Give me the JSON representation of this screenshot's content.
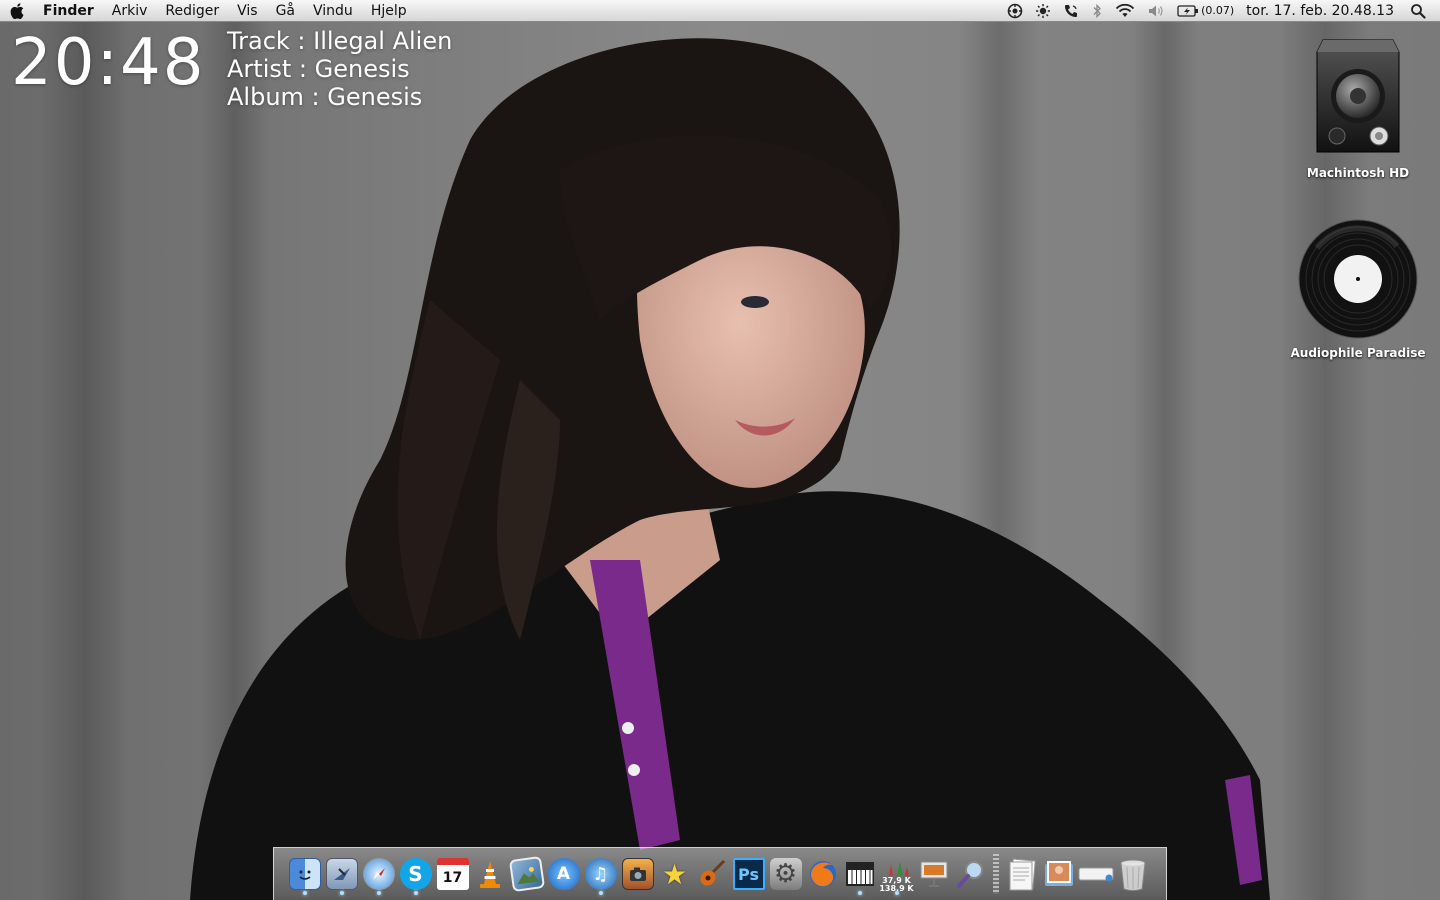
{
  "menubar": {
    "app_name": "Finder",
    "menus": [
      "Arkiv",
      "Rediger",
      "Vis",
      "Gå",
      "Vindu",
      "Hjelp"
    ],
    "status_icons": [
      "sync-icon",
      "brightness-icon",
      "phone-icon",
      "bluetooth-icon",
      "wifi-icon",
      "volume-icon"
    ],
    "battery_text": "(0.07)",
    "datetime": "tor. 17. feb.  20.48.13"
  },
  "widgets": {
    "clock": "20:48",
    "track": "Track  : Illegal Alien",
    "artist": "Artist : Genesis",
    "album": "Album : Genesis"
  },
  "desktop": {
    "icons": [
      {
        "label": "Machintosh HD",
        "icon": "hard-drive-icon"
      },
      {
        "label": "Audiophile Paradise",
        "icon": "vinyl-disc-icon"
      }
    ]
  },
  "dock": {
    "items": [
      {
        "name": "finder",
        "icon": "finder-icon",
        "running": true
      },
      {
        "name": "mail",
        "icon": "mail-icon",
        "running": true
      },
      {
        "name": "safari",
        "icon": "safari-icon",
        "running": true
      },
      {
        "name": "skype",
        "icon": "skype-icon",
        "running": true,
        "glyph": "S"
      },
      {
        "name": "ical",
        "icon": "calendar-icon",
        "running": false,
        "glyph": "17"
      },
      {
        "name": "vlc",
        "icon": "vlc-icon",
        "running": false
      },
      {
        "name": "iphoto",
        "icon": "photos-icon",
        "running": false
      },
      {
        "name": "app-store",
        "icon": "app-store-icon",
        "running": false,
        "glyph": "A"
      },
      {
        "name": "itunes",
        "icon": "itunes-icon",
        "running": true,
        "glyph": "♫"
      },
      {
        "name": "image-capture",
        "icon": "camera-icon",
        "running": false
      },
      {
        "name": "imovie",
        "icon": "star-icon",
        "running": false,
        "glyph": "★"
      },
      {
        "name": "garageband",
        "icon": "guitar-icon",
        "running": false
      },
      {
        "name": "photoshop",
        "icon": "photoshop-icon",
        "running": false,
        "glyph": "Ps"
      },
      {
        "name": "system-preferences",
        "icon": "gear-icon",
        "running": false,
        "glyph": "⚙"
      },
      {
        "name": "firefox",
        "icon": "firefox-icon",
        "running": false
      },
      {
        "name": "keyboard",
        "icon": "piano-icon",
        "running": true
      },
      {
        "name": "network-monitor",
        "icon": "network-monitor-icon",
        "running": true,
        "upload": "37,9 K",
        "download": "138,9 K"
      },
      {
        "name": "keynote",
        "icon": "keynote-icon",
        "running": false
      },
      {
        "name": "preview",
        "icon": "magnifier-icon",
        "running": false
      }
    ],
    "stacks": [
      {
        "name": "documents",
        "icon": "documents-stack-icon"
      },
      {
        "name": "pictures",
        "icon": "pictures-stack-icon"
      },
      {
        "name": "drive",
        "icon": "drive-stack-icon"
      },
      {
        "name": "trash",
        "icon": "trash-icon"
      }
    ]
  },
  "colors": {
    "backdrop": "#6f6f6f",
    "menubar": "#e8e8e8",
    "shirt_accent": "#7a2a8a"
  }
}
